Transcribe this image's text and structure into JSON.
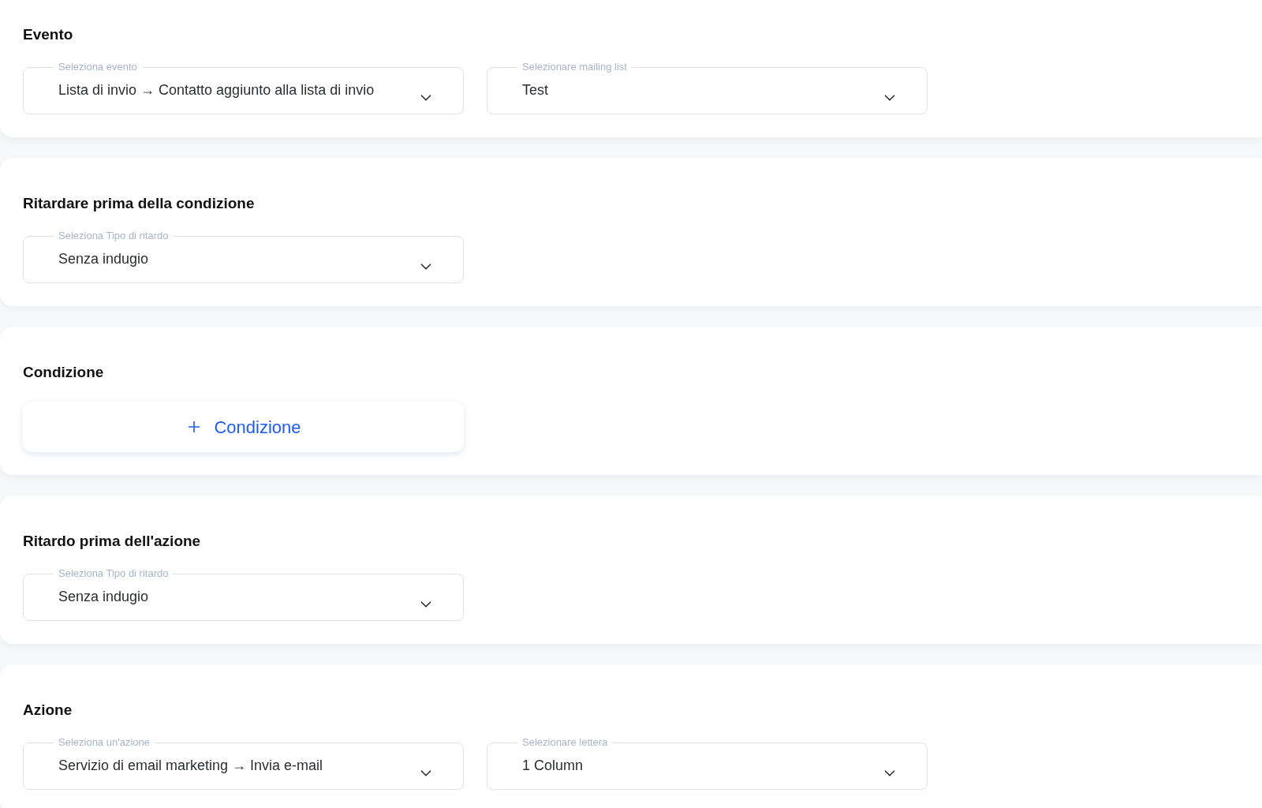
{
  "sections": [
    {
      "title": "Evento",
      "items": [
        {
          "kind": "select",
          "label": "Seleziona evento",
          "value": "Lista di invio → Contatto aggiunto alla lista di invio"
        },
        {
          "kind": "select",
          "label": "Selezionare mailing list",
          "value": "Test"
        }
      ]
    },
    {
      "title": "Ritardare prima della condizione",
      "items": [
        {
          "kind": "select",
          "label": "Seleziona Tipo di ritardo",
          "value": "Senza indugio"
        }
      ]
    },
    {
      "title": "Condizione",
      "items": [
        {
          "kind": "add_button",
          "label": "Condizione"
        }
      ]
    },
    {
      "title": "Ritardo prima dell'azione",
      "items": [
        {
          "kind": "select",
          "label": "Seleziona Tipo di ritardo",
          "value": "Senza indugio"
        }
      ]
    },
    {
      "title": "Azione",
      "items": [
        {
          "kind": "select",
          "label": "Seleziona un'azione",
          "value": "Servizio di email marketing → Invia e-mail"
        },
        {
          "kind": "select",
          "label": "Selezionare lettera",
          "value": "1 Column"
        }
      ]
    }
  ]
}
